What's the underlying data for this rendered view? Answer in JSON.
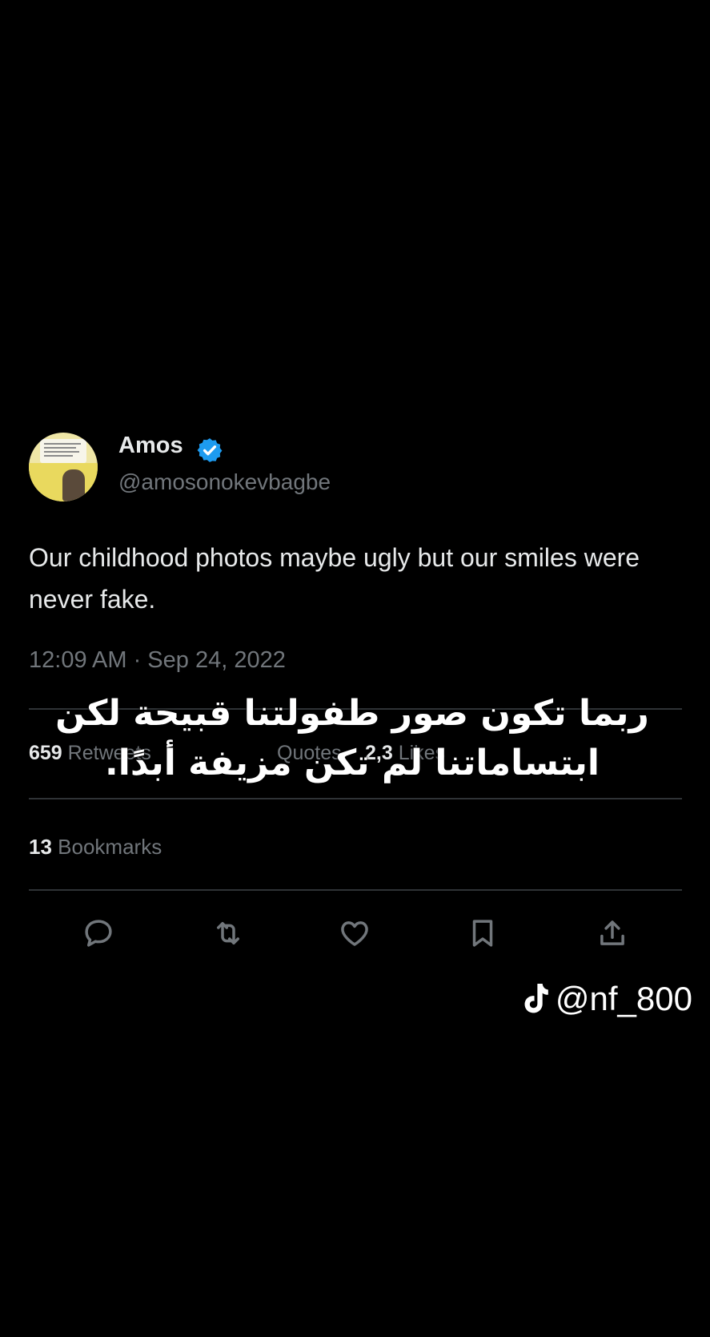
{
  "tweet": {
    "display_name": "Amos",
    "handle": "@amosonokevbagbe",
    "text": "Our childhood photos maybe ugly but our smiles were never fake.",
    "timestamp": "12:09 AM · Sep 24, 2022",
    "stats": {
      "retweets_count": "659",
      "retweets_label": "Retweets",
      "quotes_label": "Quotes",
      "likes_count": "2,3",
      "likes_label": "Likes"
    },
    "bookmarks": {
      "count": "13",
      "label": "Bookmarks"
    }
  },
  "overlay": {
    "caption_line1": "ربما تكون صور طفولتنا قبيحة لكن",
    "caption_line2": "ابتساماتنا لم تكن مزيفة أبدًا."
  },
  "watermark": {
    "text": "@nf_800",
    "icon": "tiktok-icon"
  },
  "icons": {
    "verified": "verified-badge-icon",
    "reply": "reply-icon",
    "retweet": "retweet-icon",
    "like": "heart-icon",
    "bookmark": "bookmark-icon",
    "share": "share-icon"
  },
  "colors": {
    "background": "#000000",
    "primary_text": "#e7e9ea",
    "secondary_text": "#71767b",
    "verified_blue": "#1d9bf0",
    "divider": "#2f3336"
  }
}
